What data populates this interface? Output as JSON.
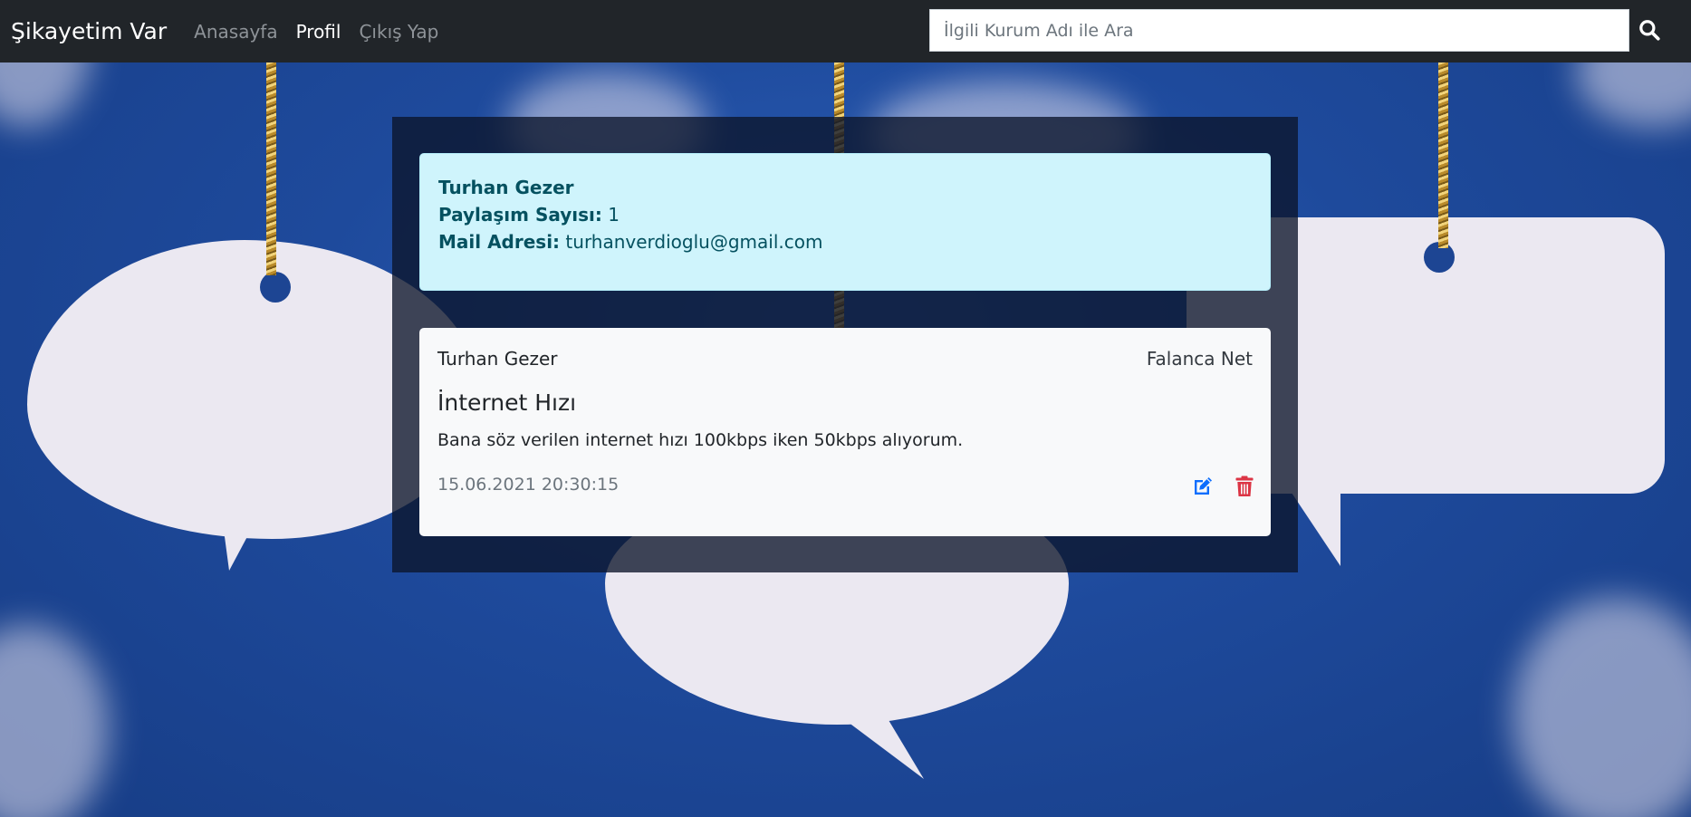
{
  "navbar": {
    "brand": "Şikayetim Var",
    "links": [
      {
        "label": "Anasayfa",
        "active": false
      },
      {
        "label": "Profil",
        "active": true
      },
      {
        "label": "Çıkış Yap",
        "active": false
      }
    ],
    "search_placeholder": "İlgili Kurum Adı ile Ara",
    "search_icon": "search-icon"
  },
  "profile": {
    "name": "Turhan Gezer",
    "post_count_label": "Paylaşım Sayısı:",
    "post_count": "1",
    "email_label": "Mail Adresi:",
    "email": "turhanverdioglu@gmail.com"
  },
  "complaint": {
    "user": "Turhan Gezer",
    "company": "Falanca Net",
    "title": "İnternet Hızı",
    "text": "Bana söz verilen internet hızı 100kbps iken 50kbps alıyorum.",
    "date": "15.06.2021 20:30:15",
    "edit_icon": "edit-icon",
    "delete_icon": "trash-icon"
  },
  "colors": {
    "navbar_bg": "#212529",
    "profile_bg": "#cff4fc",
    "profile_text": "#055160",
    "edit_icon": "#0d6efd",
    "delete_icon": "#dc3545"
  }
}
